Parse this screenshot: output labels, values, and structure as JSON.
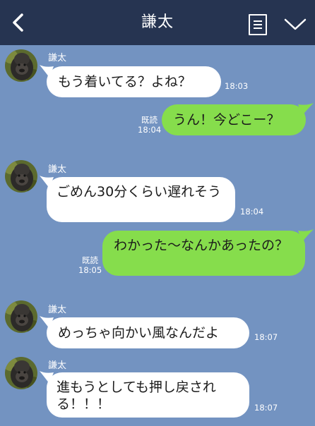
{
  "header": {
    "title": "謙太"
  },
  "colors": {
    "background": "#7393c1",
    "header": "#263451",
    "incoming_bubble": "#ffffff",
    "outgoing_bubble": "#86dd4c"
  },
  "messages": [
    {
      "direction": "in",
      "sender": "謙太",
      "text": "もう着いてる？よね？",
      "time": "18:03"
    },
    {
      "direction": "out",
      "read": "既読",
      "text": "うん！今どこー？",
      "time": "18:04"
    },
    {
      "direction": "in",
      "sender": "謙太",
      "text": "ごめん30分くらい遅れそう",
      "time": "18:04"
    },
    {
      "direction": "out",
      "read": "既読",
      "text": "わかった〜なんかあったの？",
      "time": "18:05"
    },
    {
      "direction": "in",
      "sender": "謙太",
      "text": "めっちゃ向かい風なんだよ",
      "time": "18:07"
    },
    {
      "direction": "in",
      "sender": "謙太",
      "text": "進もうとしても押し戻される！！！",
      "time": "18:07"
    }
  ]
}
